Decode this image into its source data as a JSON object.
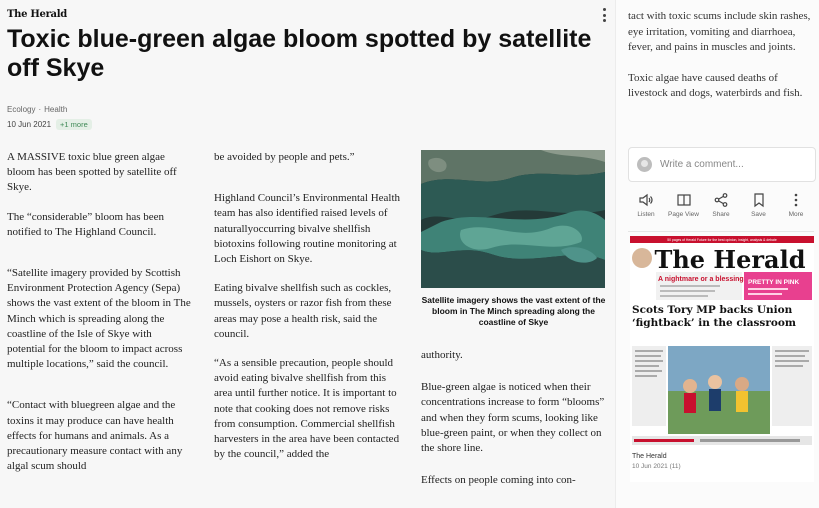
{
  "article": {
    "masthead": "The Herald",
    "headline": "Toxic blue-green algae bloom spotted by satel­lite off Skye",
    "tags": [
      "Ecology",
      "Health"
    ],
    "date": "10 Jun 2021",
    "more_tag": "+1 more",
    "col1": [
      "A MASSIVE toxic blue green algae bloom has been spotted by satellite off Skye.",
      "The “considerable” bloom has been notified to The Highland Council.",
      "“Satellite imagery provided by Scottish Environment Protection Agency (Sepa) shows the vast extent of the bloom in The Minch which is spreading along the coastline of the Isle of Skye with potential for the bloom to impact across multiple lo­cations,” said the council.",
      "“Contact with bluegreen algae and the toxins it may produce can have health effects for humans and ani­mals. As a precautionary measure contact with any algal scum should"
    ],
    "col2": [
      "be avoided by people and pets.”",
      "Highland Council’s Environmental Health team has also identified raised levels of naturallyoccurring bivalve shellfish biotoxins following routine monitoring at Loch Eishort on Skye.",
      "Eating bivalve shellfish such as cockles, mussels, oysters or razor fish from these areas may pose a health risk, said the council.",
      "“As a sensible precaution, people should avoid eating bivalve shellfish from this area until further notice. It is important to note that cooking does not remove risks from con­sumption. Commercial shellfish harvesters in the area have been contacted by the council,” added the"
    ],
    "col3": [
      "authority.",
      "Blue-green algae is noticed when their concentrations increase to form “blooms” and when they form scums, looking like blue-green paint, or when they collect on the shore line.",
      "Effects on people coming into con-"
    ],
    "image_caption": "Satellite imagery shows the vast extent of the bloom in The Minch spreading along the coastline of Skye"
  },
  "sidebar": {
    "continued": [
      "tact with toxic scums include skin rashes, eye irritation, vomiting and diarrhoea, fever, and pains in mus­cles and joints.",
      "Toxic algae have caused deaths of livestock and dogs, waterbirds and fish."
    ],
    "comment_placeholder": "Write a comment...",
    "actions": [
      {
        "label": "Listen",
        "icon": "speaker-icon"
      },
      {
        "label": "Page View",
        "icon": "page-view-icon"
      },
      {
        "label": "Share",
        "icon": "share-icon"
      },
      {
        "label": "Save",
        "icon": "bookmark-icon"
      },
      {
        "label": "More",
        "icon": "more-vertical-icon"
      }
    ],
    "edition": {
      "banner": "50 pages of Herald Future for the best opinion, insight, analysis & debate",
      "title": "The Herald",
      "teaser1": "A nightmare or a blessing?",
      "teaser2": "PRETTY IN PINK",
      "headline": "Scots Tory MP backs Union ‘fightback’ in the classroom",
      "publication": "The Herald",
      "date_label": "10 Jun 2021 (11)"
    }
  },
  "colors": {
    "accent_green": "#3f8a57",
    "herald_red": "#c8102e"
  }
}
